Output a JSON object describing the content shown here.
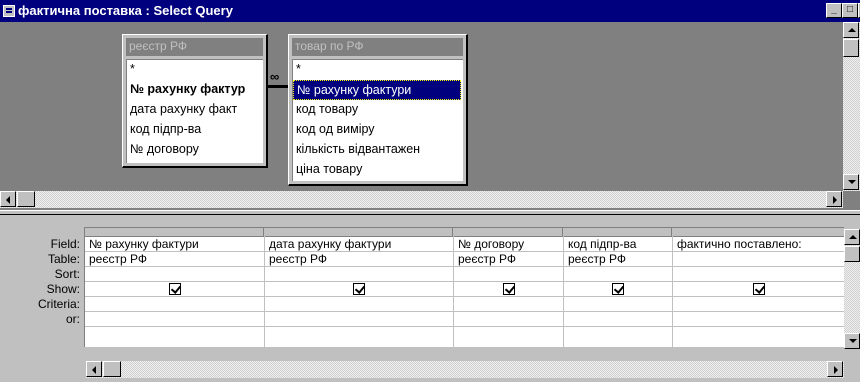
{
  "window": {
    "title": "фактична поставка : Select Query",
    "minimize": "_",
    "maximize": "□",
    "close": "×"
  },
  "tables": [
    {
      "title": "реєстр РФ",
      "fields": [
        "*",
        "№ рахунку фактур",
        "дата  рахунку факт",
        "код підпр-ва",
        "№ договору"
      ]
    },
    {
      "title": "товар по РФ",
      "fields": [
        "*",
        "№ рахунку фактури",
        "код товару",
        "код од виміру",
        "кількість відвантажен",
        "ціна товару"
      ]
    }
  ],
  "join_symbol": "∞",
  "grid": {
    "row_labels": [
      "Field:",
      "Table:",
      "Sort:",
      "Show:",
      "Criteria:",
      "or:"
    ],
    "columns": [
      {
        "field": "№ рахунку фактури",
        "table": "реєстр РФ",
        "sort": "",
        "show": true,
        "criteria": "",
        "or": ""
      },
      {
        "field": "дата  рахунку фактури",
        "table": "реєстр РФ",
        "sort": "",
        "show": true,
        "criteria": "",
        "or": ""
      },
      {
        "field": "№ договору",
        "table": "реєстр РФ",
        "sort": "",
        "show": true,
        "criteria": "",
        "or": ""
      },
      {
        "field": "код підпр-ва",
        "table": "реєстр РФ",
        "sort": "",
        "show": true,
        "criteria": "",
        "or": ""
      },
      {
        "field": "фактично поставлено:",
        "table": "",
        "sort": "",
        "show": true,
        "criteria": "",
        "or": ""
      }
    ]
  }
}
